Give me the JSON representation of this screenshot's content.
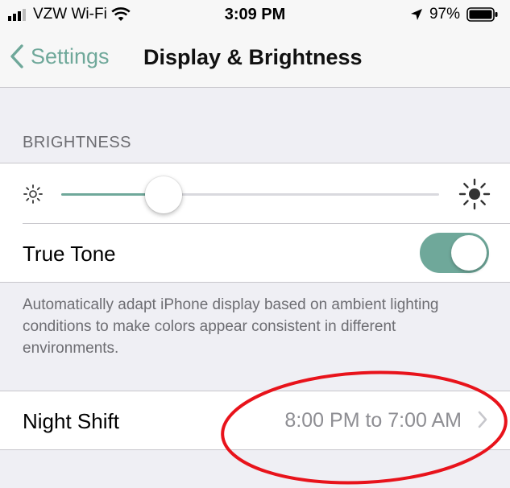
{
  "status_bar": {
    "carrier": "VZW Wi-Fi",
    "time": "3:09 PM",
    "battery_percent": "97%",
    "signal_icon": "signal-bars-icon",
    "wifi_icon": "wifi-icon",
    "location_icon": "location-arrow-icon",
    "battery_icon": "battery-icon",
    "battery_level": 0.97
  },
  "nav": {
    "back_label": "Settings",
    "title": "Display & Brightness"
  },
  "brightness": {
    "section_header": "BRIGHTNESS",
    "slider_value": 0.27,
    "accent_color": "#6fa89a"
  },
  "true_tone": {
    "label": "True Tone",
    "enabled": true,
    "footer": "Automatically adapt iPhone display based on ambient lighting conditions to make colors appear consistent in different environments."
  },
  "night_shift": {
    "label": "Night Shift",
    "value": "8:00 PM to 7:00 AM"
  },
  "annotation": {
    "color": "#e8131b"
  }
}
